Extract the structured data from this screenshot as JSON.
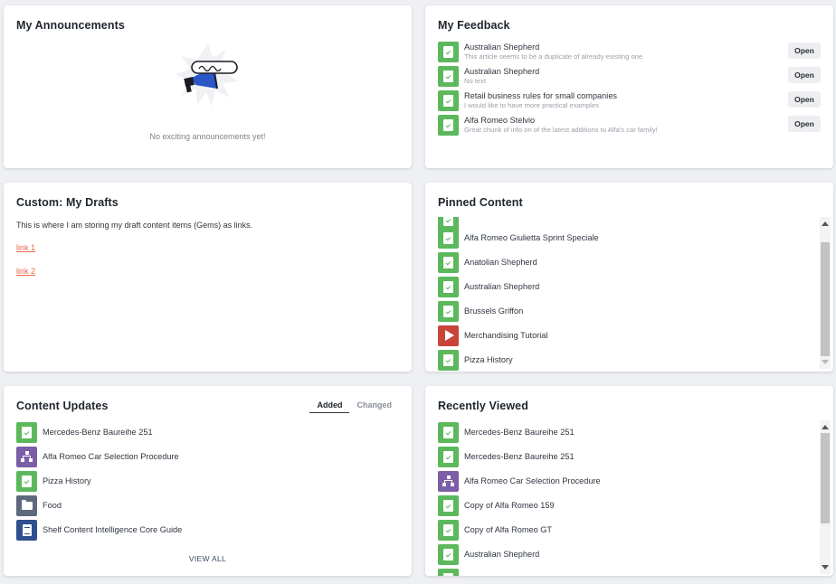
{
  "announcements": {
    "title": "My Announcements",
    "empty_text": "No exciting announcements yet!"
  },
  "feedback": {
    "title": "My Feedback",
    "open_label": "Open",
    "items": [
      {
        "title": "Australian Shepherd",
        "comment": "This article seems to be a duplicate of already existing one"
      },
      {
        "title": "Australian Shepherd",
        "comment": "No text"
      },
      {
        "title": "Retail business rules for small companies",
        "comment": "I would like to have more practical examples"
      },
      {
        "title": "Alfa Romeo Stelvio",
        "comment": "Great chunk of info on of the latest additions to Alfa's car family!"
      }
    ]
  },
  "drafts": {
    "title": "Custom: My Drafts",
    "description": "This is where I am storing my draft content items (Gems) as links.",
    "links": [
      "link 1",
      "link 2"
    ]
  },
  "pinned": {
    "title": "Pinned Content",
    "items": [
      {
        "title": "",
        "icon": "gem-icon"
      },
      {
        "title": "Alfa Romeo Giulietta Sprint Speciale",
        "icon": "gem-icon"
      },
      {
        "title": "Anatolian Shepherd",
        "icon": "gem-icon"
      },
      {
        "title": "Australian Shepherd",
        "icon": "gem-icon"
      },
      {
        "title": "Brussels Griffon",
        "icon": "gem-icon"
      },
      {
        "title": "Merchandising Tutorial",
        "icon": "video-icon"
      },
      {
        "title": "Pizza History",
        "icon": "gem-icon"
      }
    ]
  },
  "updates": {
    "title": "Content Updates",
    "tabs": [
      "Added",
      "Changed"
    ],
    "active_tab": "Added",
    "items": [
      {
        "title": "Mercedes-Benz Baureihe 251",
        "icon": "gem-icon"
      },
      {
        "title": "Alfa Romeo Car Selection Procedure",
        "icon": "flowchart-icon"
      },
      {
        "title": "Pizza History",
        "icon": "gem-icon"
      },
      {
        "title": "Food",
        "icon": "folder-icon"
      },
      {
        "title": "Shelf Content Intelligence Core Guide",
        "icon": "document-icon"
      }
    ],
    "view_all": "VIEW ALL"
  },
  "recent": {
    "title": "Recently Viewed",
    "items": [
      {
        "title": "Mercedes-Benz Baureihe 251",
        "icon": "gem-icon"
      },
      {
        "title": "Mercedes-Benz Baureihe 251",
        "icon": "gem-icon"
      },
      {
        "title": "Alfa Romeo Car Selection Procedure",
        "icon": "flowchart-icon"
      },
      {
        "title": "Copy of Alfa Romeo 159",
        "icon": "gem-icon"
      },
      {
        "title": "Copy of Alfa Romeo GT",
        "icon": "gem-icon"
      },
      {
        "title": "Australian Shepherd",
        "icon": "gem-icon"
      },
      {
        "title": "",
        "icon": "gem-icon"
      }
    ]
  },
  "colors": {
    "gem": "#5cb85c",
    "flowchart": "#7b5ea7",
    "folder": "#5d6a7e",
    "document": "#2f4f8f",
    "video": "#c9443a",
    "link": "#e8684a"
  }
}
